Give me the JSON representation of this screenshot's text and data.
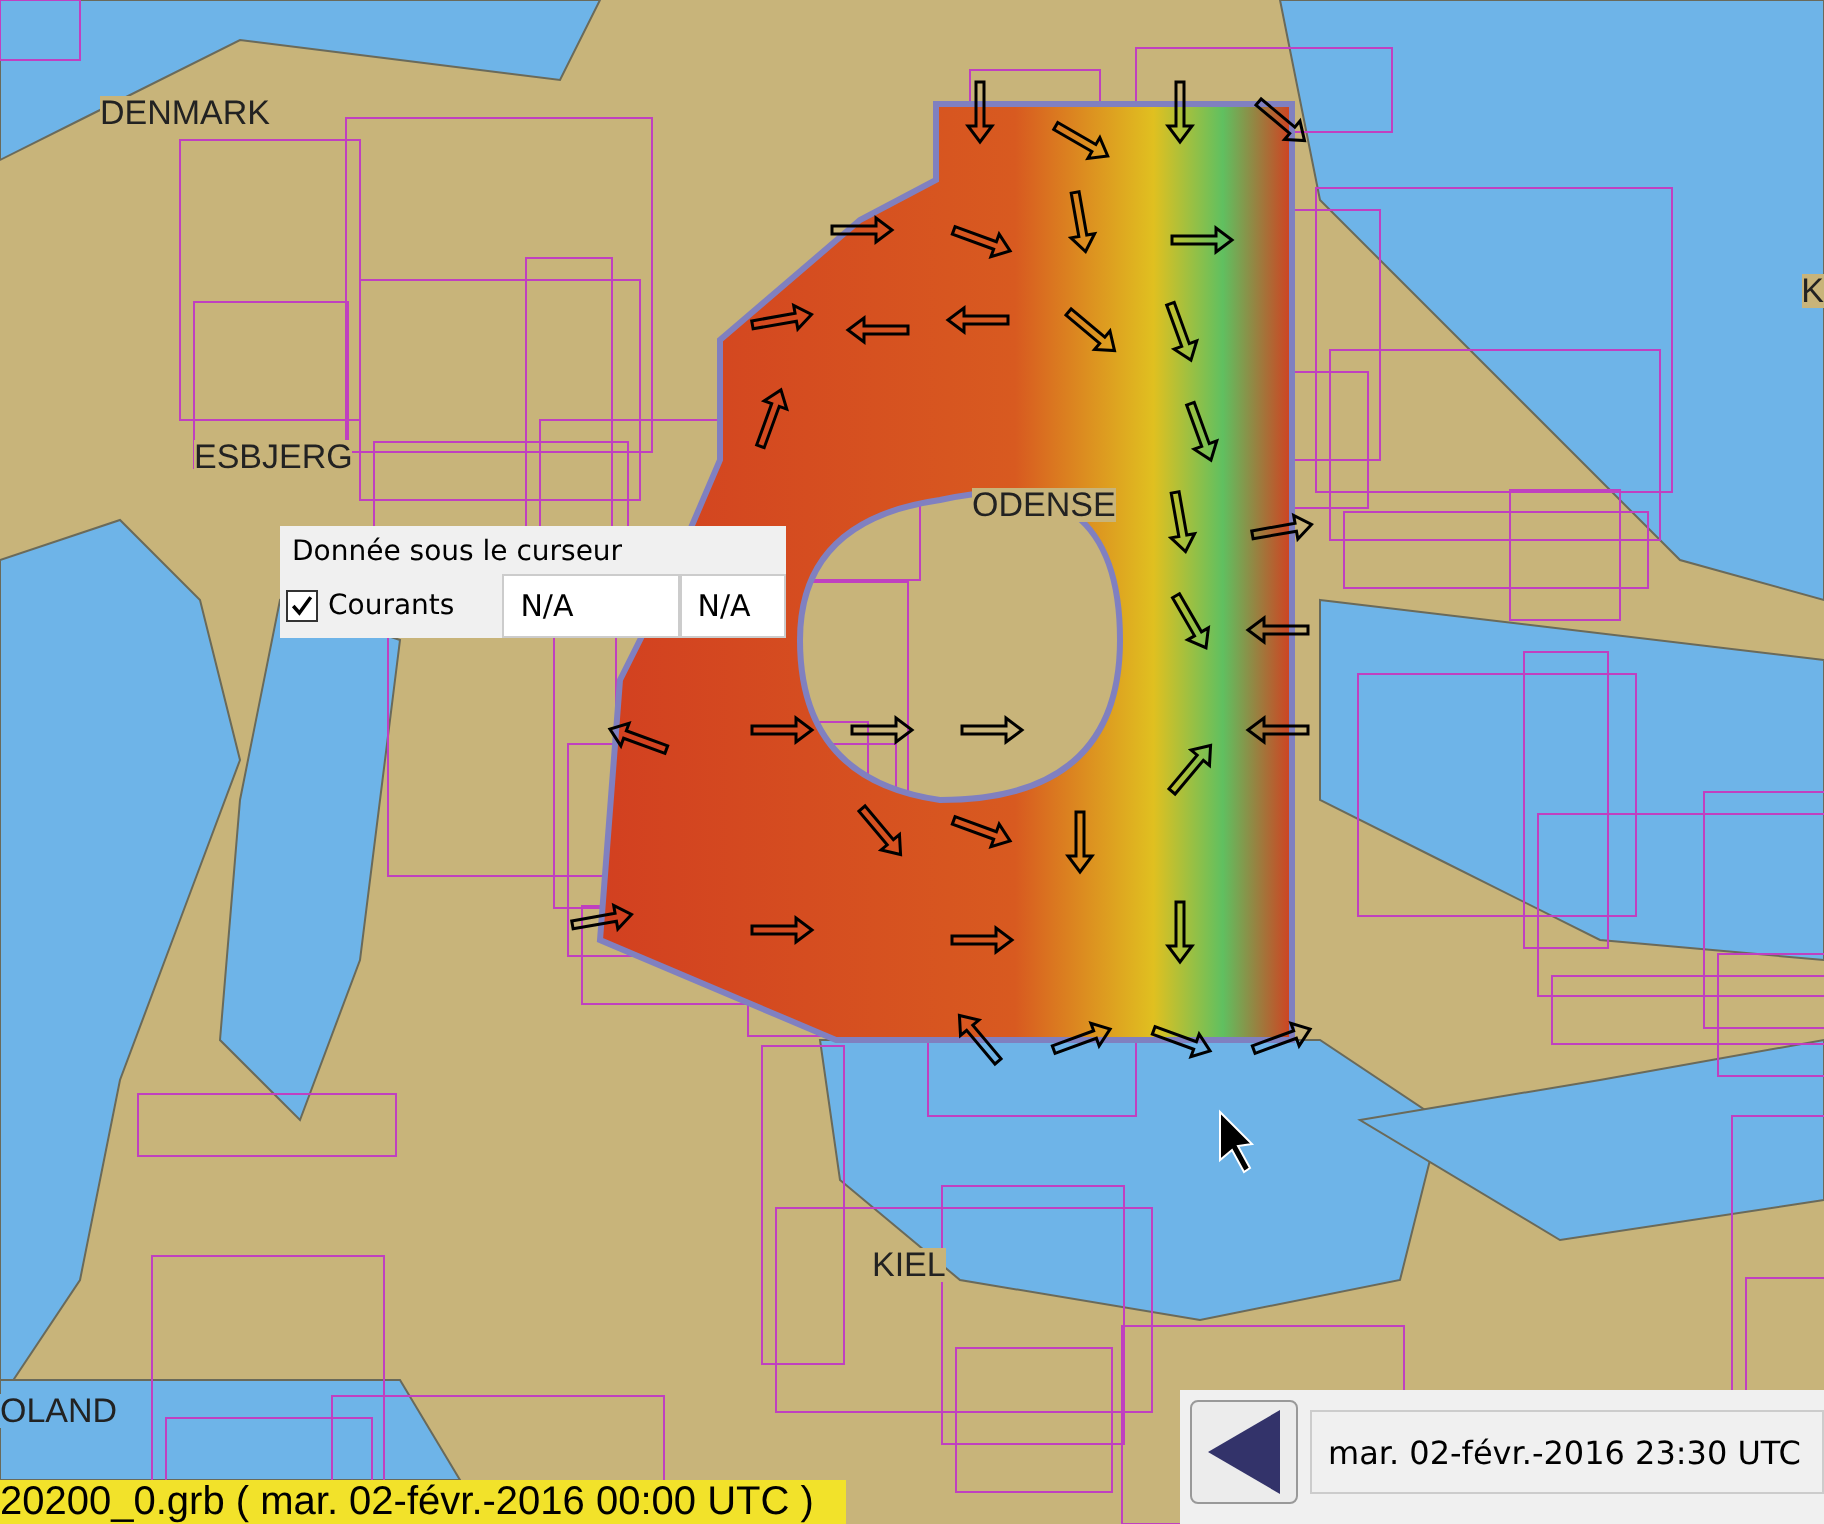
{
  "map": {
    "labels": [
      {
        "text": "DENMARK"
      },
      {
        "text": "ESBJERG"
      },
      {
        "text": "ODENSE"
      },
      {
        "text": "KIEL"
      },
      {
        "text": "OLAND"
      },
      {
        "text": "K"
      }
    ]
  },
  "cursor_panel": {
    "title": "Donnée sous le curseur",
    "layers": [
      {
        "label": "Courants",
        "checked": true,
        "value_1": "N/A",
        "value_2": "N/A"
      }
    ]
  },
  "file_bar": {
    "text": "20200_0.grb ( mar. 02-févr.-2016 00:00  UTC )"
  },
  "time_control": {
    "time": "mar. 02-févr.-2016 23:30  UTC"
  }
}
